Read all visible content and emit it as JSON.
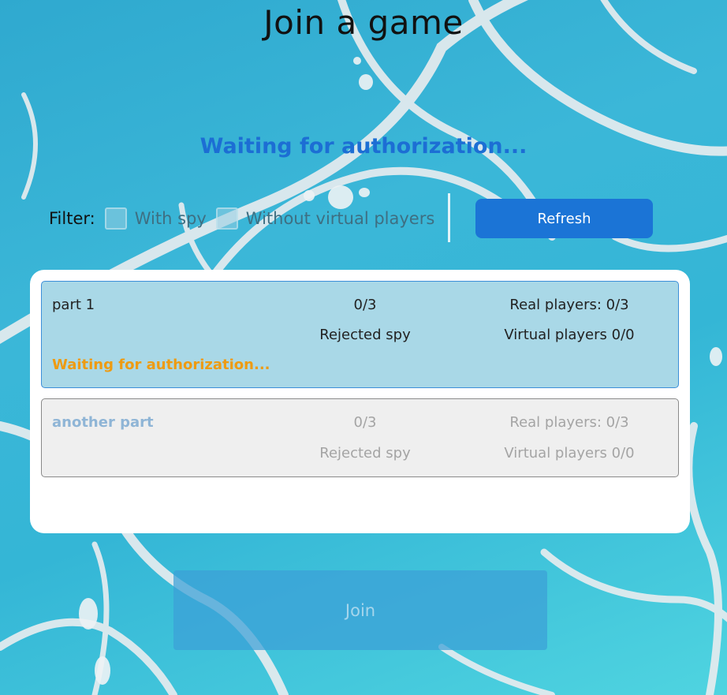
{
  "page": {
    "title": "Join a game",
    "status": "Waiting for authorization..."
  },
  "filter": {
    "label": "Filter:",
    "with_spy_label": "With spy",
    "with_spy_checked": false,
    "without_virtual_label": "Without virtual players",
    "without_virtual_checked": false
  },
  "refresh": {
    "label": "Refresh"
  },
  "games": [
    {
      "name": "part 1",
      "players": "0/3",
      "spy": "Rejected spy",
      "real_players": "Real players: 0/3",
      "virtual_players": "Virtual players 0/0",
      "status": "Waiting for authorization...",
      "selected": true
    },
    {
      "name": "another part",
      "players": "0/3",
      "spy": "Rejected spy",
      "real_players": "Real players: 0/3",
      "virtual_players": "Virtual players 0/0",
      "status": "",
      "selected": false
    }
  ],
  "join": {
    "label": "Join",
    "enabled": false
  },
  "colors": {
    "accent": "#1b74d6",
    "status_blue": "#1c6ed4",
    "status_orange": "#ee9b12",
    "selected_row": "#a9d8e7",
    "disabled_row": "#efefef"
  }
}
